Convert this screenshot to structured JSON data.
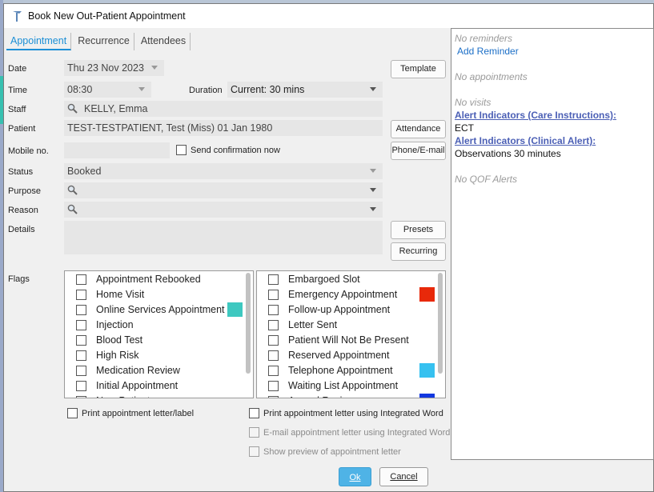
{
  "window": {
    "title": "Book New Out-Patient Appointment"
  },
  "tabs": [
    {
      "label": "Appointment",
      "active": true
    },
    {
      "label": "Recurrence",
      "active": false
    },
    {
      "label": "Attendees",
      "active": false
    }
  ],
  "form": {
    "date_label": "Date",
    "date_value": "Thu 23 Nov 2023",
    "time_label": "Time",
    "time_value": "08:30",
    "duration_label": "Duration",
    "duration_value": "Current: 30 mins",
    "staff_label": "Staff",
    "staff_value": "KELLY, Emma",
    "patient_label": "Patient",
    "patient_value": "TEST-TESTPATIENT, Test (Miss) 01 Jan 1980",
    "mobile_label": "Mobile no.",
    "mobile_value": "",
    "send_confirmation_label": "Send confirmation now",
    "status_label": "Status",
    "status_value": "Booked",
    "purpose_label": "Purpose",
    "purpose_value": "",
    "reason_label": "Reason",
    "reason_value": "",
    "details_label": "Details",
    "details_value": "",
    "flags_label": "Flags"
  },
  "buttons": {
    "template": "Template",
    "attendance": "Attendance",
    "phone_email": "Phone/E-mail",
    "presets": "Presets",
    "recurring": "Recurring",
    "ok": "Ok",
    "cancel": "Cancel"
  },
  "flags_left": [
    {
      "label": "Appointment Rebooked",
      "color": null
    },
    {
      "label": "Home Visit",
      "color": null
    },
    {
      "label": "Online Services Appointment",
      "color": "#3ec8c0"
    },
    {
      "label": "Injection",
      "color": null
    },
    {
      "label": "Blood Test",
      "color": null
    },
    {
      "label": "High Risk",
      "color": null
    },
    {
      "label": "Medication Review",
      "color": null
    },
    {
      "label": "Initial Appointment",
      "color": null
    },
    {
      "label": "New Patient",
      "color": null
    }
  ],
  "flags_right": [
    {
      "label": "Embargoed Slot",
      "color": null
    },
    {
      "label": "Emergency Appointment",
      "color": "#e8290a"
    },
    {
      "label": "Follow-up Appointment",
      "color": null
    },
    {
      "label": "Letter Sent",
      "color": null
    },
    {
      "label": "Patient Will Not Be Present",
      "color": null
    },
    {
      "label": "Reserved Appointment",
      "color": null
    },
    {
      "label": "Telephone Appointment",
      "color": "#36c1f0"
    },
    {
      "label": "Waiting List Appointment",
      "color": null
    },
    {
      "label": "Annual Review",
      "color": "#1238e0"
    }
  ],
  "options": {
    "print_letter_label": "Print appointment letter/label",
    "print_word": "Print appointment letter using Integrated Word",
    "email_word": "E-mail appointment letter using Integrated Word",
    "show_preview": "Show preview of appointment letter"
  },
  "side_panel": {
    "no_reminders": "No reminders",
    "add_reminder": "Add Reminder",
    "no_appointments": "No appointments",
    "no_visits": "No visits",
    "alert_care_title": "Alert Indicators (Care Instructions):",
    "alert_care_value": "ECT",
    "alert_clinical_title": "Alert Indicators (Clinical Alert):",
    "alert_clinical_value": "Observations 30 minutes",
    "no_qof": "No QOF Alerts"
  }
}
